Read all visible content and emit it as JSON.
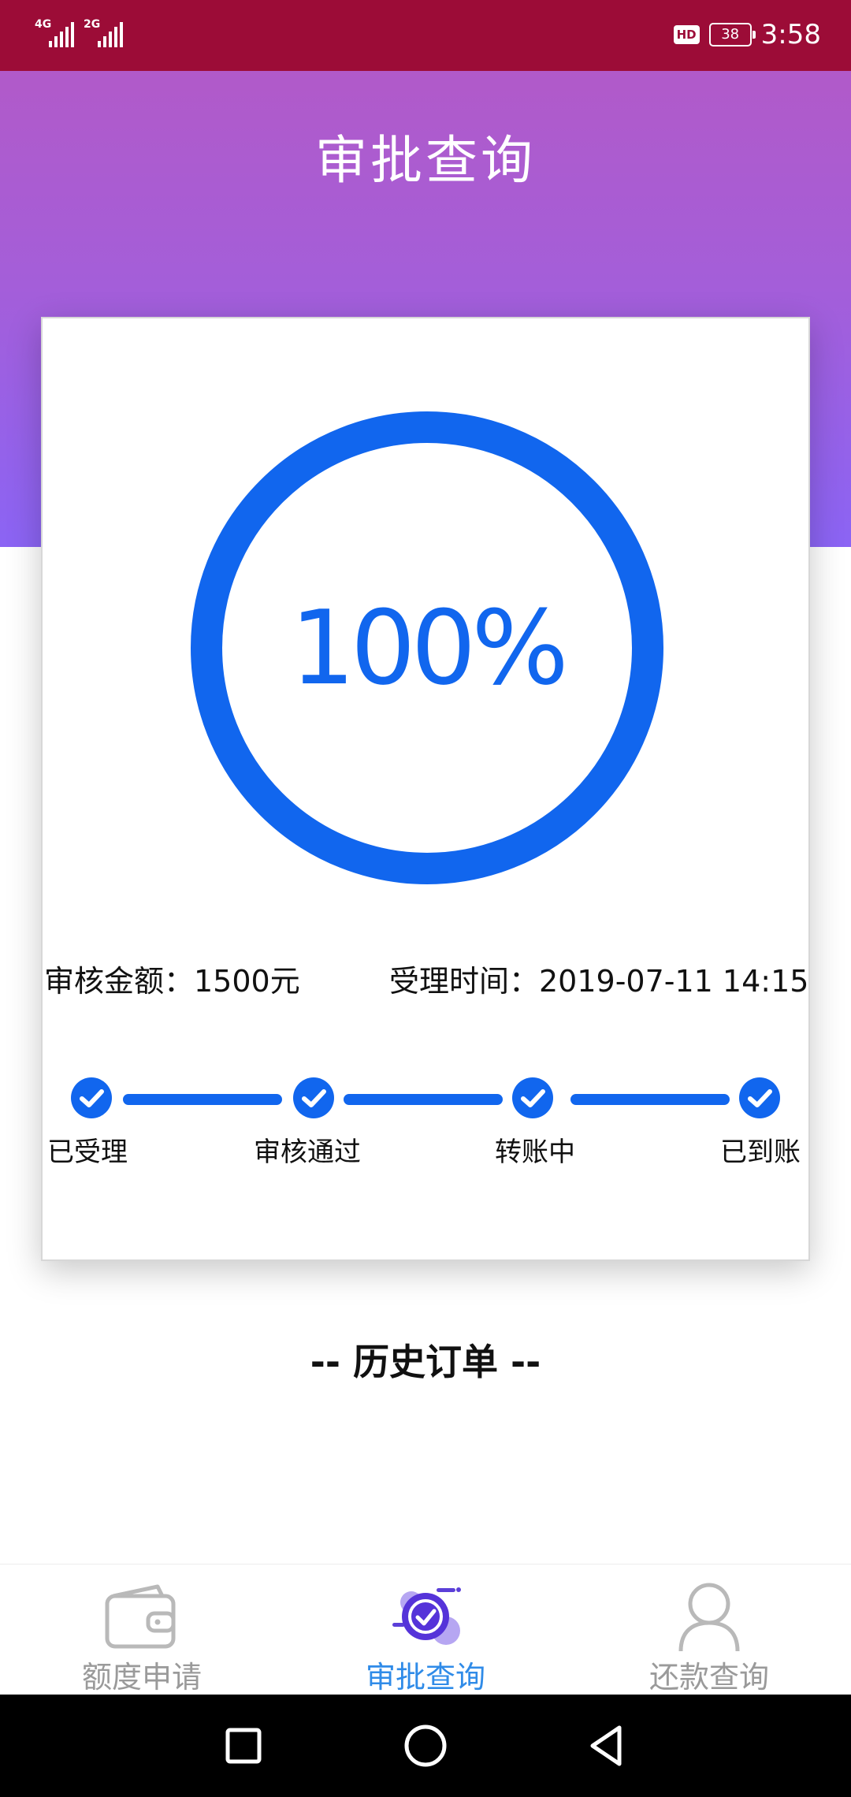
{
  "status_bar": {
    "network_1": "4G",
    "network_2": "2G",
    "hd_badge": "HD",
    "battery": "38",
    "time": "3:58"
  },
  "header": {
    "title": "审批查询"
  },
  "card": {
    "progress_text": "100%",
    "progress_value": 100,
    "ring_color": "#1166EE",
    "amount_label": "审核金额：1500元",
    "time_label": "受理时间：2019-07-11 14:15",
    "steps": [
      {
        "label": "已受理",
        "done": true
      },
      {
        "label": "审核通过",
        "done": true
      },
      {
        "label": "转账中",
        "done": true
      },
      {
        "label": "已到账",
        "done": true
      }
    ]
  },
  "history": {
    "title": "-- 历史订单 --"
  },
  "bottom_nav": {
    "items": [
      {
        "label": "额度申请",
        "icon": "wallet-icon",
        "active": false
      },
      {
        "label": "审批查询",
        "icon": "approval-check-icon",
        "active": true
      },
      {
        "label": "还款查询",
        "icon": "user-icon",
        "active": false
      }
    ],
    "active_color": "#2F8BE8",
    "inactive_color": "#9A9A9A"
  },
  "system_nav": {
    "buttons": [
      "recent-apps-icon",
      "home-icon",
      "back-icon"
    ]
  }
}
